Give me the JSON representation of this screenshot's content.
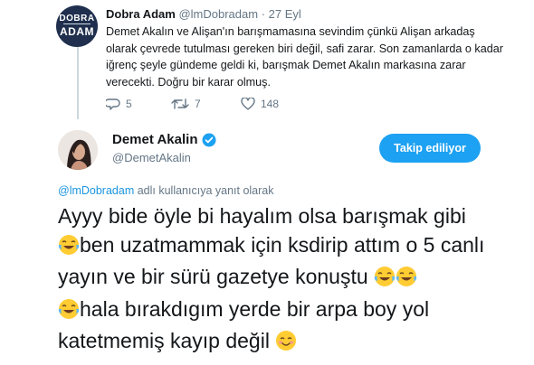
{
  "quoted_tweet": {
    "avatar_line1": "DOBRA",
    "avatar_line2": "ADAM",
    "name": "Dobra Adam",
    "handle": "@lmDobradam",
    "separator": "·",
    "date": "27 Eyl",
    "text": "Demet Akalın ve Alişan'ın barışmamasına sevindim çünkü Alişan arkadaş olarak çevrede tutulması gereken biri değil, safi zarar. Son zamanlarda o kadar iğrenç şeyle gündeme geldi ki, barışmak Demet Akalın markasına zarar verecekti. Doğru bir karar olmuş.",
    "actions": {
      "replies": "5",
      "retweets": "7",
      "likes": "148"
    }
  },
  "main_tweet": {
    "name": "Demet Akalin",
    "handle": "@DemetAkalin",
    "follow_label": "Takip ediliyor",
    "reply_mention": "@lmDobradam",
    "reply_suffix": " adlı kullanıcıya yanıt olarak",
    "text_parts": {
      "p1": "Ayyy bide öyle bi hayalım olsa barışmak gibi",
      "p2": "ben uzatmammak için ksdirip attım o 5 canlı yayın ve bir sürü gazetye konuştu",
      "p3": "hala bırakdıgım yerde bir arpa boy yol katetmemiş kayıp değil"
    }
  },
  "colors": {
    "accent": "#1da1f2",
    "secondary_text": "#657786",
    "link": "#1b95e0"
  },
  "icons": [
    "reply-icon",
    "retweet-icon",
    "like-icon",
    "verified-badge-icon",
    "tears-of-joy-emoji",
    "smiling-blush-emoji"
  ]
}
